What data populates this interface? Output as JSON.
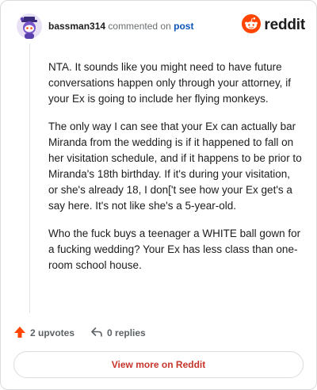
{
  "header": {
    "username": "bassman314",
    "action_text": "commented on",
    "post_link_label": "post",
    "brand_name": "reddit",
    "brand_color": "#ff4500"
  },
  "comment": {
    "paragraphs": [
      "NTA. It sounds like you might need to have future conversations happen only through your attorney, if your Ex is going to include her flying monkeys.",
      "The only way I can see that your Ex can actually bar Miranda from the wedding is if it happened to fall on her visitation schedule, and if it happens to be prior to Miranda's 18th birthday. If it's during your visitation, or she's already 18, I don['t see how your Ex get's a say here. It's not like she's a 5-year-old.",
      "Who the fuck buys a teenager a WHITE ball gown for a fucking wedding? Your Ex has less class than one-room school house."
    ]
  },
  "actions": {
    "upvotes_label": "2 upvotes",
    "replies_label": "0 replies",
    "upvote_color": "#ff4500"
  },
  "footer": {
    "view_more_label": "View more on Reddit",
    "view_more_color": "#c7352a"
  },
  "icons": {
    "avatar": "snoo-avatar-icon",
    "brand": "reddit-logo-icon",
    "upvote": "upvote-arrow-icon",
    "reply": "reply-arrow-icon"
  }
}
